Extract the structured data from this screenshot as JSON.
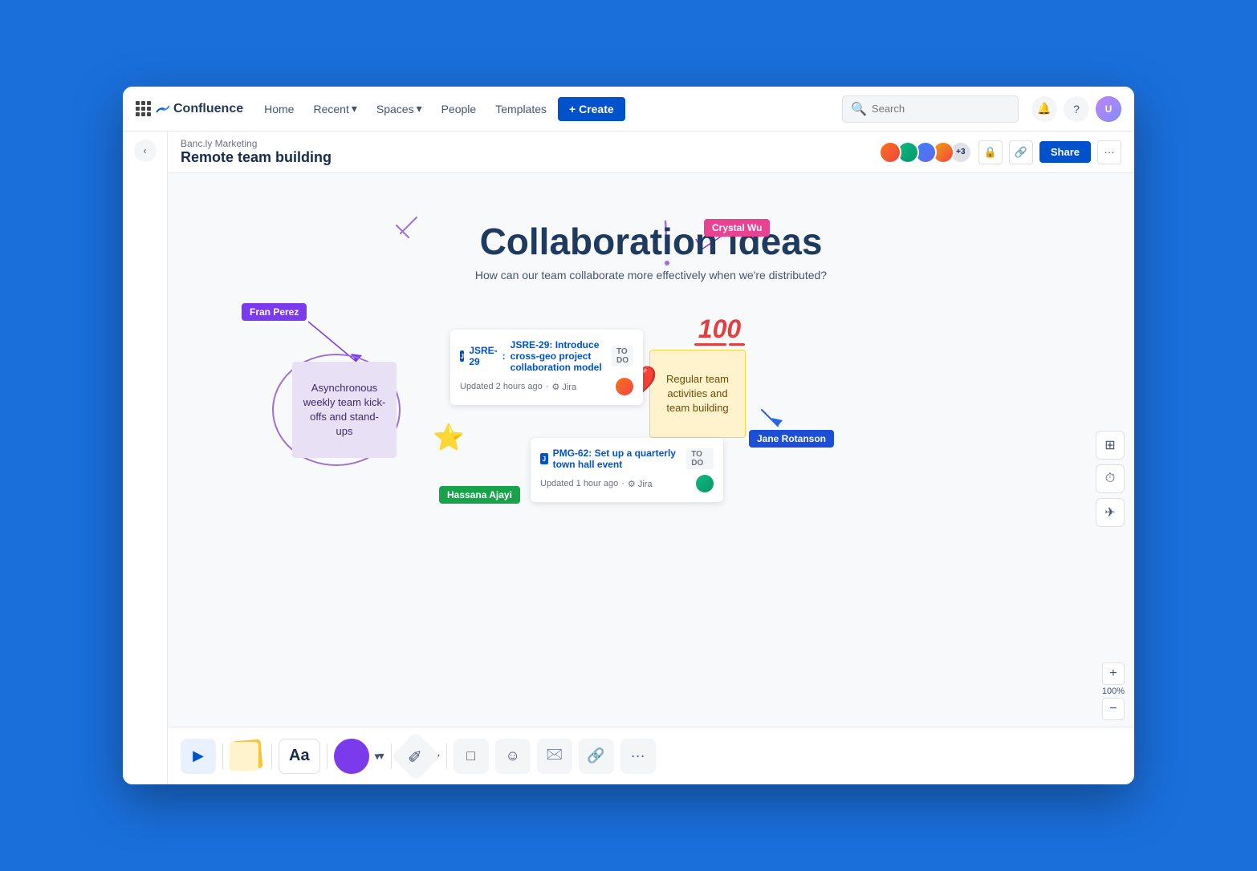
{
  "app": {
    "title": "Confluence",
    "logo_icon": "confluence-icon"
  },
  "nav": {
    "home": "Home",
    "recent": "Recent",
    "spaces": "Spaces",
    "people": "People",
    "templates": "Templates",
    "create": "+ Create"
  },
  "search": {
    "placeholder": "Search"
  },
  "breadcrumb": {
    "parent": "Banc.ly Marketing",
    "current": "Remote team building"
  },
  "page": {
    "title": "Remote team building",
    "share_label": "Share"
  },
  "whiteboard": {
    "title": "Collaboration ideas",
    "subtitle": "How can our team collaborate more effectively when we're distributed?",
    "sticky_note_1": "Asynchronous weekly team kick-offs and stand-ups",
    "sticky_note_2": "Regular team activities and team building",
    "jira_card_1": {
      "id": "JSRE-29",
      "title": "Introduce cross-geo project collaboration model",
      "status": "TO DO",
      "updated": "Updated 2 hours ago",
      "source": "Jira"
    },
    "jira_card_2": {
      "id": "PMG-62",
      "title": "Set up a quarterly town hall event",
      "status": "TO DO",
      "updated": "Updated 1 hour ago",
      "source": "Jira"
    },
    "user_labels": {
      "crystal_wu": "Crystal Wu",
      "fran_perez": "Fran Perez",
      "hassana_ajayi": "Hassana Ajayi",
      "jane_rotanson": "Jane Rotanson"
    },
    "hundred_emoji": "100"
  },
  "toolbar": {
    "zoom_level": "100%",
    "font_label": "Aa",
    "zoom_plus": "+",
    "zoom_minus": "−"
  },
  "avatars": {
    "count_label": "+3"
  }
}
